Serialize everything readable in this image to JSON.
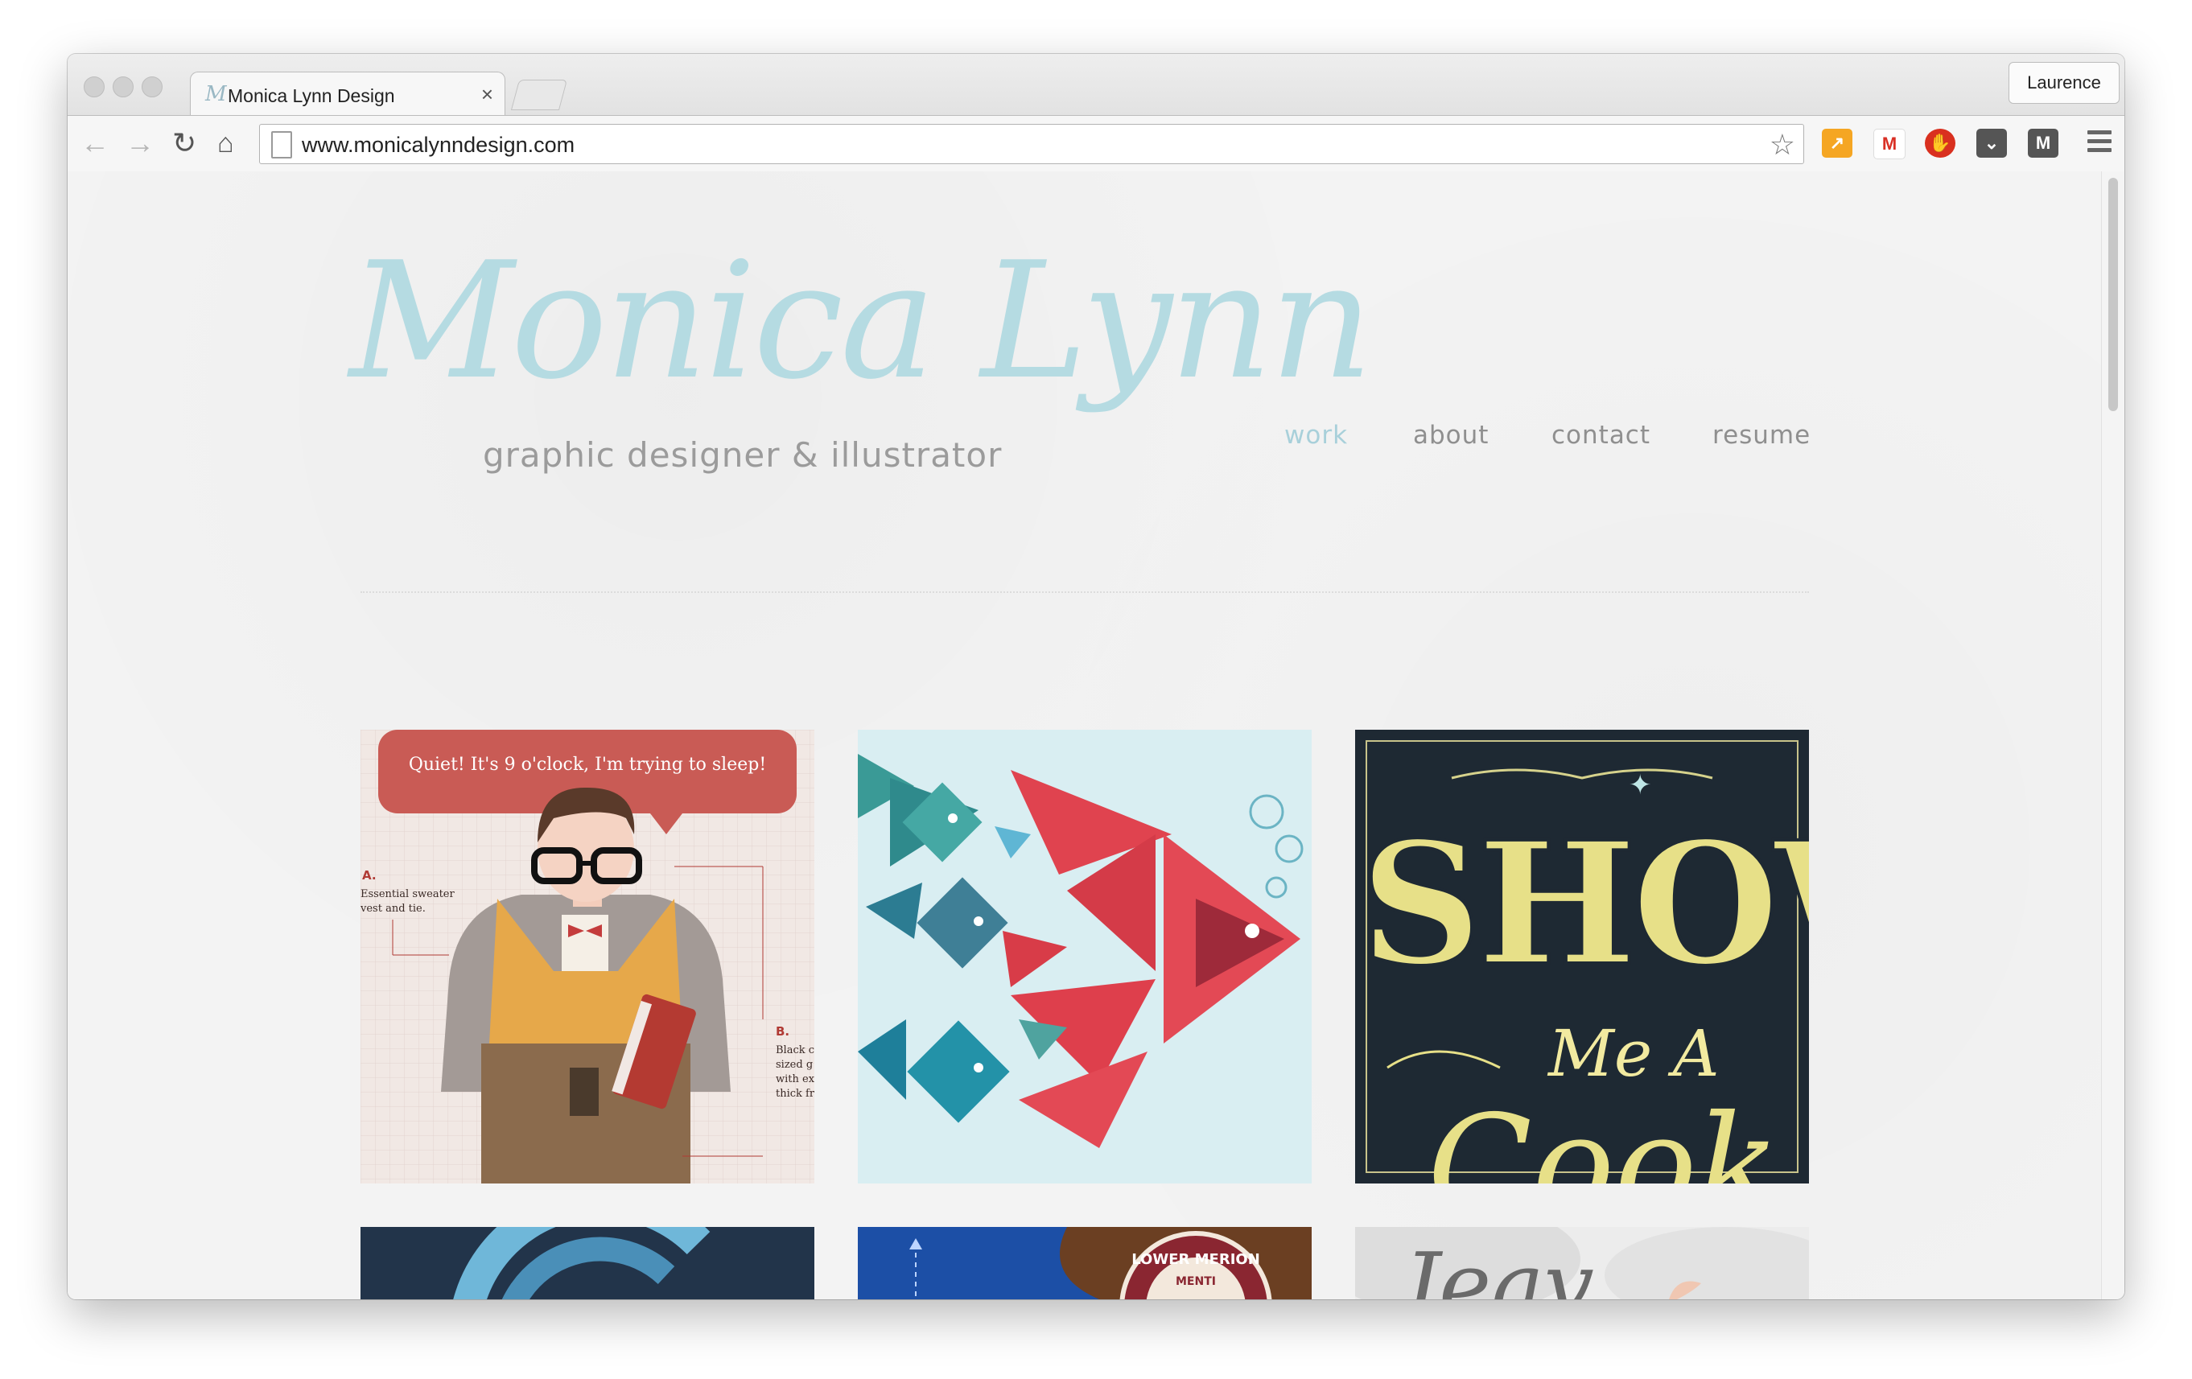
{
  "browser": {
    "tab_title": "Monica Lynn Design",
    "tab_favicon": "M",
    "tab_close": "×",
    "profile_name": "Laurence",
    "url": "www.monicalynndesign.com",
    "nav_icons": [
      "back-icon",
      "forward-icon",
      "reload-icon",
      "home-icon"
    ],
    "extensions": [
      {
        "name": "analytics-extension-icon",
        "color": "#f5a623"
      },
      {
        "name": "gmail-extension-icon",
        "color": "#d93025"
      },
      {
        "name": "adblock-extension-icon",
        "color": "#d9301f"
      },
      {
        "name": "pocket-extension-icon",
        "color": "#555555"
      },
      {
        "name": "medium-extension-icon",
        "color": "#555555"
      }
    ]
  },
  "site": {
    "logo_name": "Monica Lynn",
    "logo_tagline": "graphic designer & illustrator",
    "accent_color": "#a8d0da",
    "nav": [
      {
        "label": "work",
        "active": true
      },
      {
        "label": "about",
        "active": false
      },
      {
        "label": "contact",
        "active": false
      },
      {
        "label": "resume",
        "active": false
      }
    ]
  },
  "portfolio": {
    "tile1": {
      "speech": "Quiet! It's 9 o'clock, I'm trying to sleep!",
      "label_a": "A.",
      "note_a_1": "Essential sweater",
      "note_a_2": "vest and tie.",
      "label_b": "B.",
      "note_b_1": "Black c",
      "note_b_2": "sized g",
      "note_b_3": "with ex",
      "note_b_4": "thick fr"
    },
    "tile3": {
      "word1": "SHOW",
      "word2": "Me A",
      "word3": "Cook"
    },
    "tile5": {
      "seal_top": "LOWER MERION",
      "seal_inner": "MENTI"
    },
    "tile6": {
      "script": "Jeav"
    }
  }
}
